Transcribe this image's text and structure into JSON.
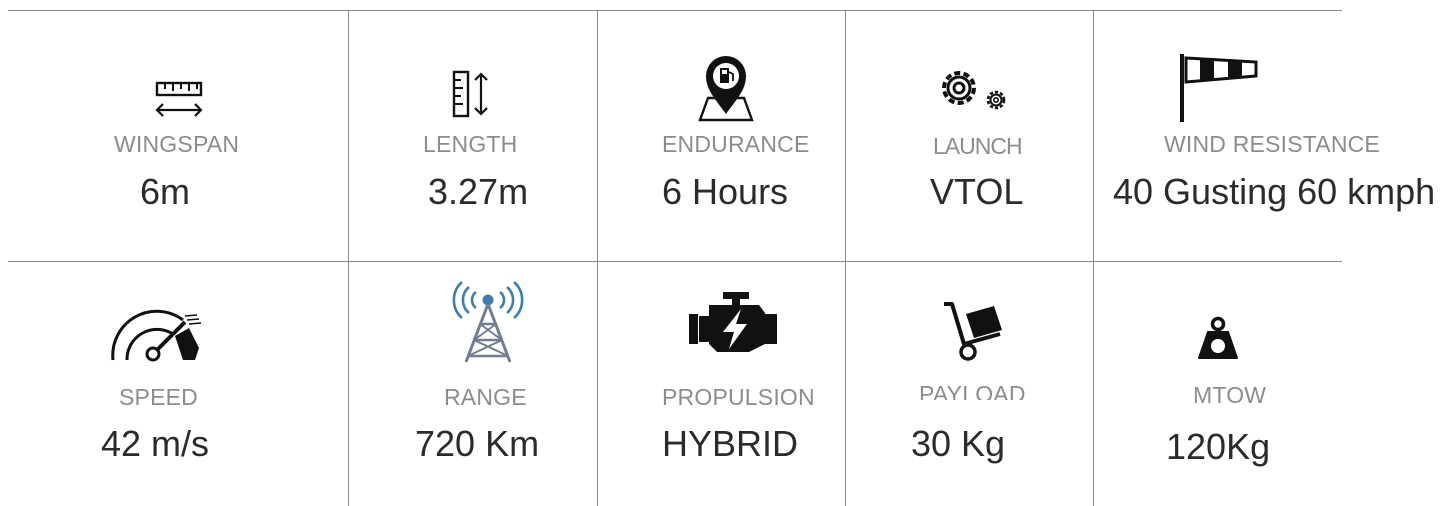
{
  "specs": [
    {
      "label": "WINGSPAN",
      "value": "6m",
      "icon": "ruler-arrows-icon"
    },
    {
      "label": "LENGTH",
      "value": "3.27m",
      "icon": "vertical-ruler-icon"
    },
    {
      "label": "ENDURANCE",
      "value": "6 Hours",
      "icon": "fuel-map-pin-icon"
    },
    {
      "label": "LAUNCH",
      "value": "VTOL",
      "icon": "gears-icon"
    },
    {
      "label": "WIND RESISTANCE",
      "value": "40 Gusting 60 kmph",
      "icon": "windsock-icon"
    },
    {
      "label": "SPEED",
      "value": "42 m/s",
      "icon": "speedometer-icon"
    },
    {
      "label": "RANGE",
      "value": "720 Km",
      "icon": "radio-tower-icon"
    },
    {
      "label": "PROPULSION",
      "value": "HYBRID",
      "icon": "engine-icon"
    },
    {
      "label": "PAYLOAD",
      "value": "30 Kg",
      "icon": "hand-truck-icon"
    },
    {
      "label": "MTOW",
      "value": "120Kg",
      "icon": "weight-icon"
    }
  ],
  "colors": {
    "text": "#2b2b2b",
    "label": "#8c8c8c",
    "icon": "#111111",
    "tower_accent": "#3a7fb0",
    "tower_body": "#6f7f8f",
    "divider": "#8a8a8a"
  }
}
